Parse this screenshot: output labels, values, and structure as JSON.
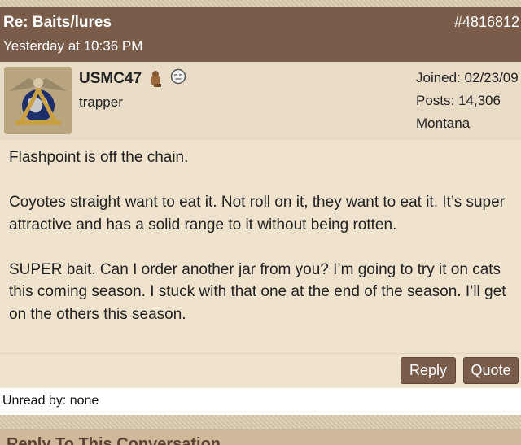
{
  "post": {
    "subject": "Re: Baits/lures",
    "post_number": "#4816812",
    "timestamp": "Yesterday at 10:36 PM"
  },
  "user": {
    "name": "USMC47",
    "title": "trapper",
    "joined": "Joined: 02/23/09",
    "posts": "Posts: 14,306",
    "location": "Montana",
    "icons": [
      "beaver-icon",
      "offline-status-icon"
    ]
  },
  "body": {
    "paragraphs": [
      "Flashpoint is off the chain.",
      "Coyotes straight want to eat it. Not roll on it, they want to eat it. It’s super attractive and has a solid range to it without being rotten.",
      "SUPER bait. Can I order another jar from you? I’m going to try it on cats this coming season. I stuck with that one at the end of the season. I’ll get on the others this season."
    ]
  },
  "actions": {
    "reply_label": "Reply",
    "quote_label": "Quote"
  },
  "status": {
    "unread": "Unread by: none"
  },
  "footer": {
    "heading": "Reply To This Conversation"
  },
  "colors": {
    "header_bg": "#7a5c4b",
    "button_bg": "#7a5c4b",
    "body_bg": "#efe3cd"
  }
}
